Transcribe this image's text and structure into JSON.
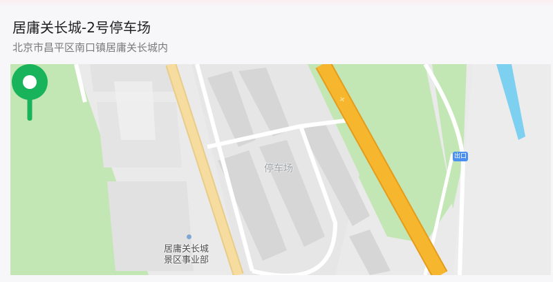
{
  "location": {
    "title": "居庸关长城-2号停车场",
    "address": "北京市昌平区南口镇居庸关长城内"
  },
  "map": {
    "marker_label": "停车场",
    "exit_badge": "出口",
    "poi_line1": "居庸关长城",
    "poi_line2": "景区事业部",
    "pin_color": "#19b35c",
    "green_area_color": "#c3e6b5",
    "highway_color": "#f6b72e",
    "road_color": "#f7dca0",
    "water_color": "#7ed0f0"
  }
}
